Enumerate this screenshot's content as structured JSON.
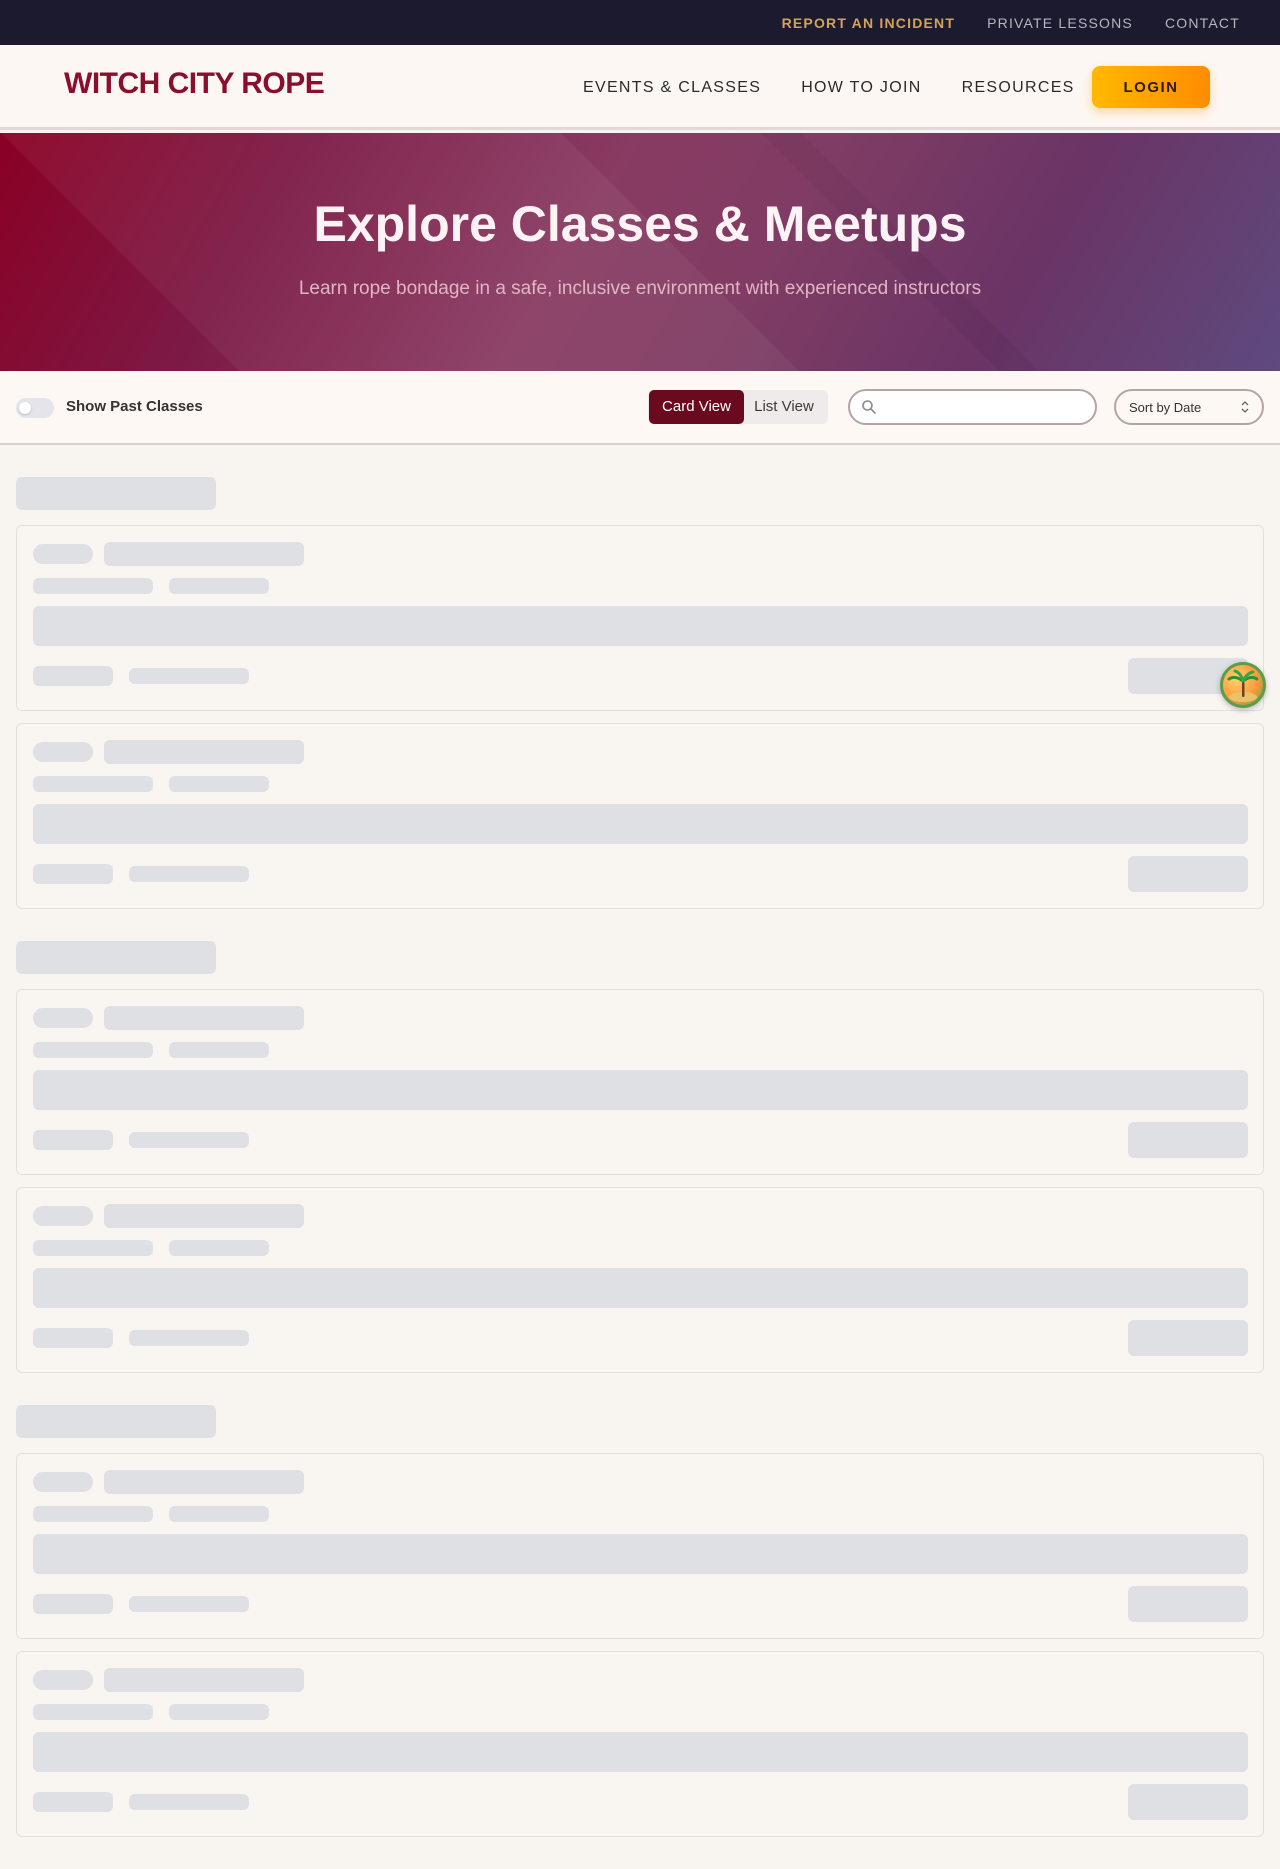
{
  "utility_bar": {
    "links": [
      "REPORT AN INCIDENT",
      "PRIVATE LESSONS",
      "CONTACT"
    ]
  },
  "header": {
    "logo": "WITCH CITY ROPE",
    "nav": [
      "EVENTS & CLASSES",
      "HOW TO JOIN",
      "RESOURCES"
    ],
    "login_label": "LOGIN"
  },
  "hero": {
    "title": "Explore Classes & Meetups",
    "subtitle": "Learn rope bondage in a safe, inclusive environment with experienced instructors"
  },
  "filters": {
    "show_past_label": "Show Past Classes",
    "show_past_enabled": false,
    "view_options": [
      "Card View",
      "List View"
    ],
    "active_view": "Card View",
    "search_value": "",
    "sort_selected": "Sort by Date"
  },
  "content": {
    "state": "loading",
    "skeleton_sections": 3,
    "skeleton_cards_per_section": 2
  },
  "colors": {
    "brand": "#8a0f2c",
    "utility_bg": "#1b1a2e",
    "accent_link": "#d2a35c",
    "login_gradient": [
      "#ffb800",
      "#ff8c00"
    ],
    "active_view_bg": "#6a0a1f",
    "skeleton": "#dfe0e4"
  },
  "icons": {
    "search": "search-icon",
    "sort": "chevron-updown-icon",
    "widget": "island-widget-icon"
  }
}
